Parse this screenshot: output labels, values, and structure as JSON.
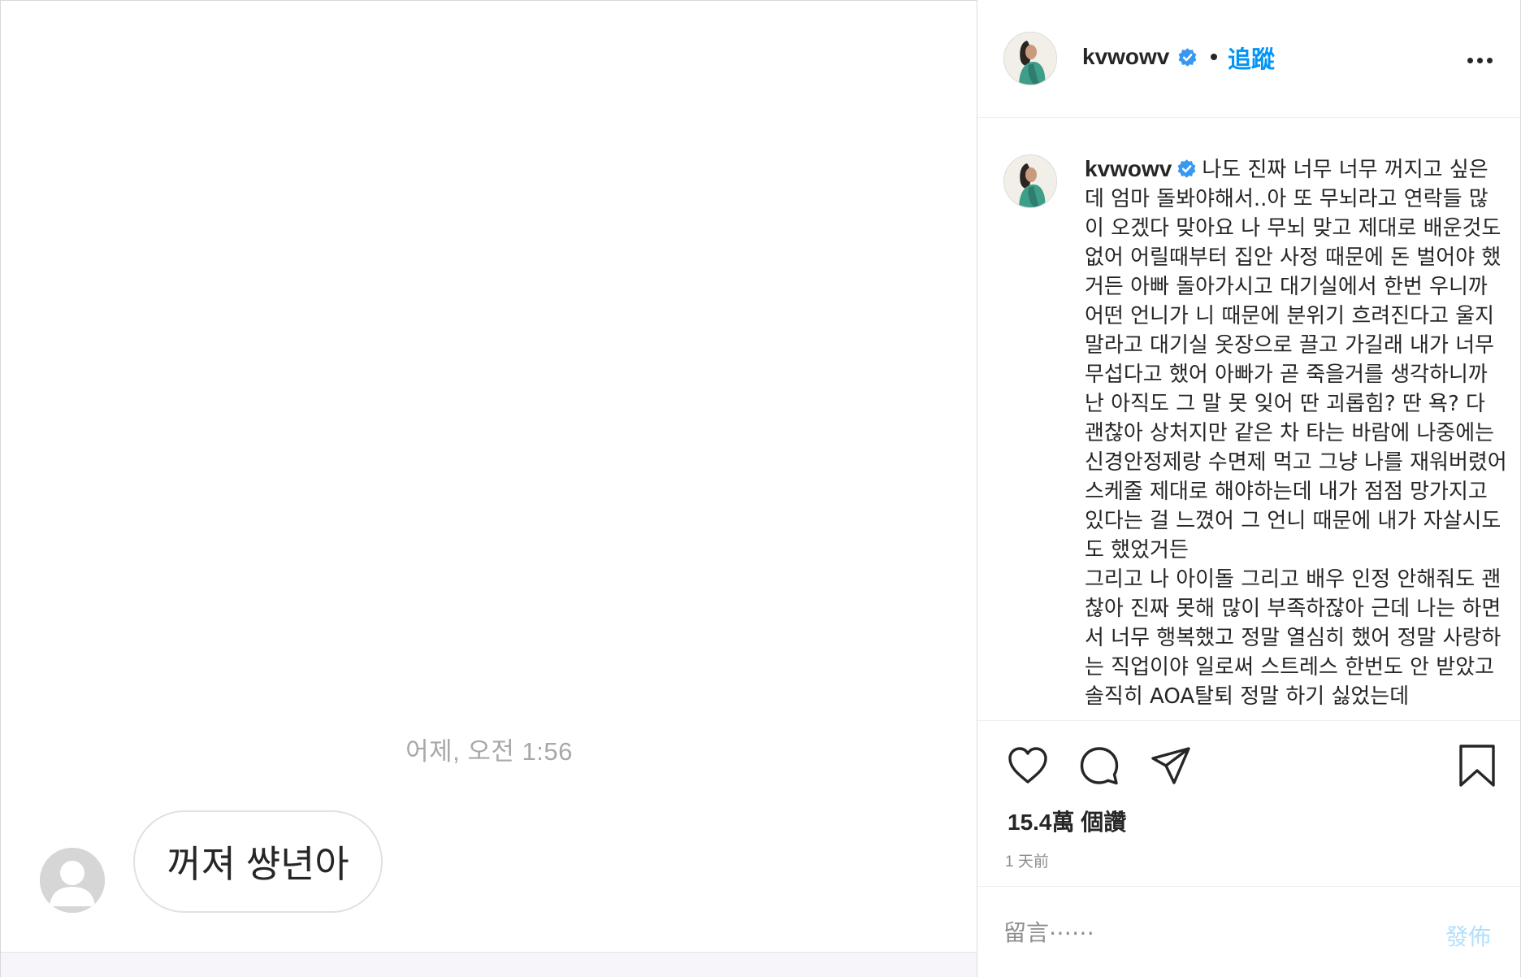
{
  "chat": {
    "timestamp": "어제, 오전 1:56",
    "message": "꺼져 썅년아"
  },
  "post": {
    "username": "kvwowv",
    "follow_label": "追蹤",
    "caption": "나도 진짜 너무 너무 꺼지고 싶은데 엄마 돌봐야해서..아 또 무뇌라고 연락들 많이 오겠다 맞아요 나 무뇌 맞고 제대로 배운것도 없어 어릴때부터 집안 사정 때문에 돈 벌어야 했거든 아빠 돌아가시고 대기실에서 한번 우니까 어떤 언니가 니 때문에 분위기 흐려진다고 울지말라고 대기실 옷장으로 끌고 가길래 내가 너무 무섭다고 했어 아빠가 곧 죽을거를 생각하니까 난 아직도 그 말 못 잊어 딴 괴롭힘? 딴 욕? 다 괜찮아 상처지만 같은 차 타는 바람에 나중에는 신경안정제랑 수면제 먹고 그냥 나를 재워버렸어 스케줄 제대로 해야하는데 내가 점점 망가지고 있다는 걸 느꼈어 그 언니 때문에 내가 자살시도도 했었거든\n그리고 나 아이돌 그리고 배우 인정 안해줘도 괜찮아 진짜 못해 많이 부족하잖아 근데 나는 하면서 너무 행복했고 정말 열심히 했어 정말 사랑하는 직업이야 일로써 스트레스 한번도 안 받았고 솔직히 AOA탈퇴 정말 하기 싫었는데",
    "likes": "15.4萬 個讚",
    "time_ago": "1 天前",
    "comment_placeholder": "留言⋯⋯",
    "post_label": "發佈"
  },
  "colors": {
    "accent": "#0095f6",
    "verified": "#3897f0",
    "muted": "#8e8e8e",
    "post_disabled": "#b2dffc"
  }
}
